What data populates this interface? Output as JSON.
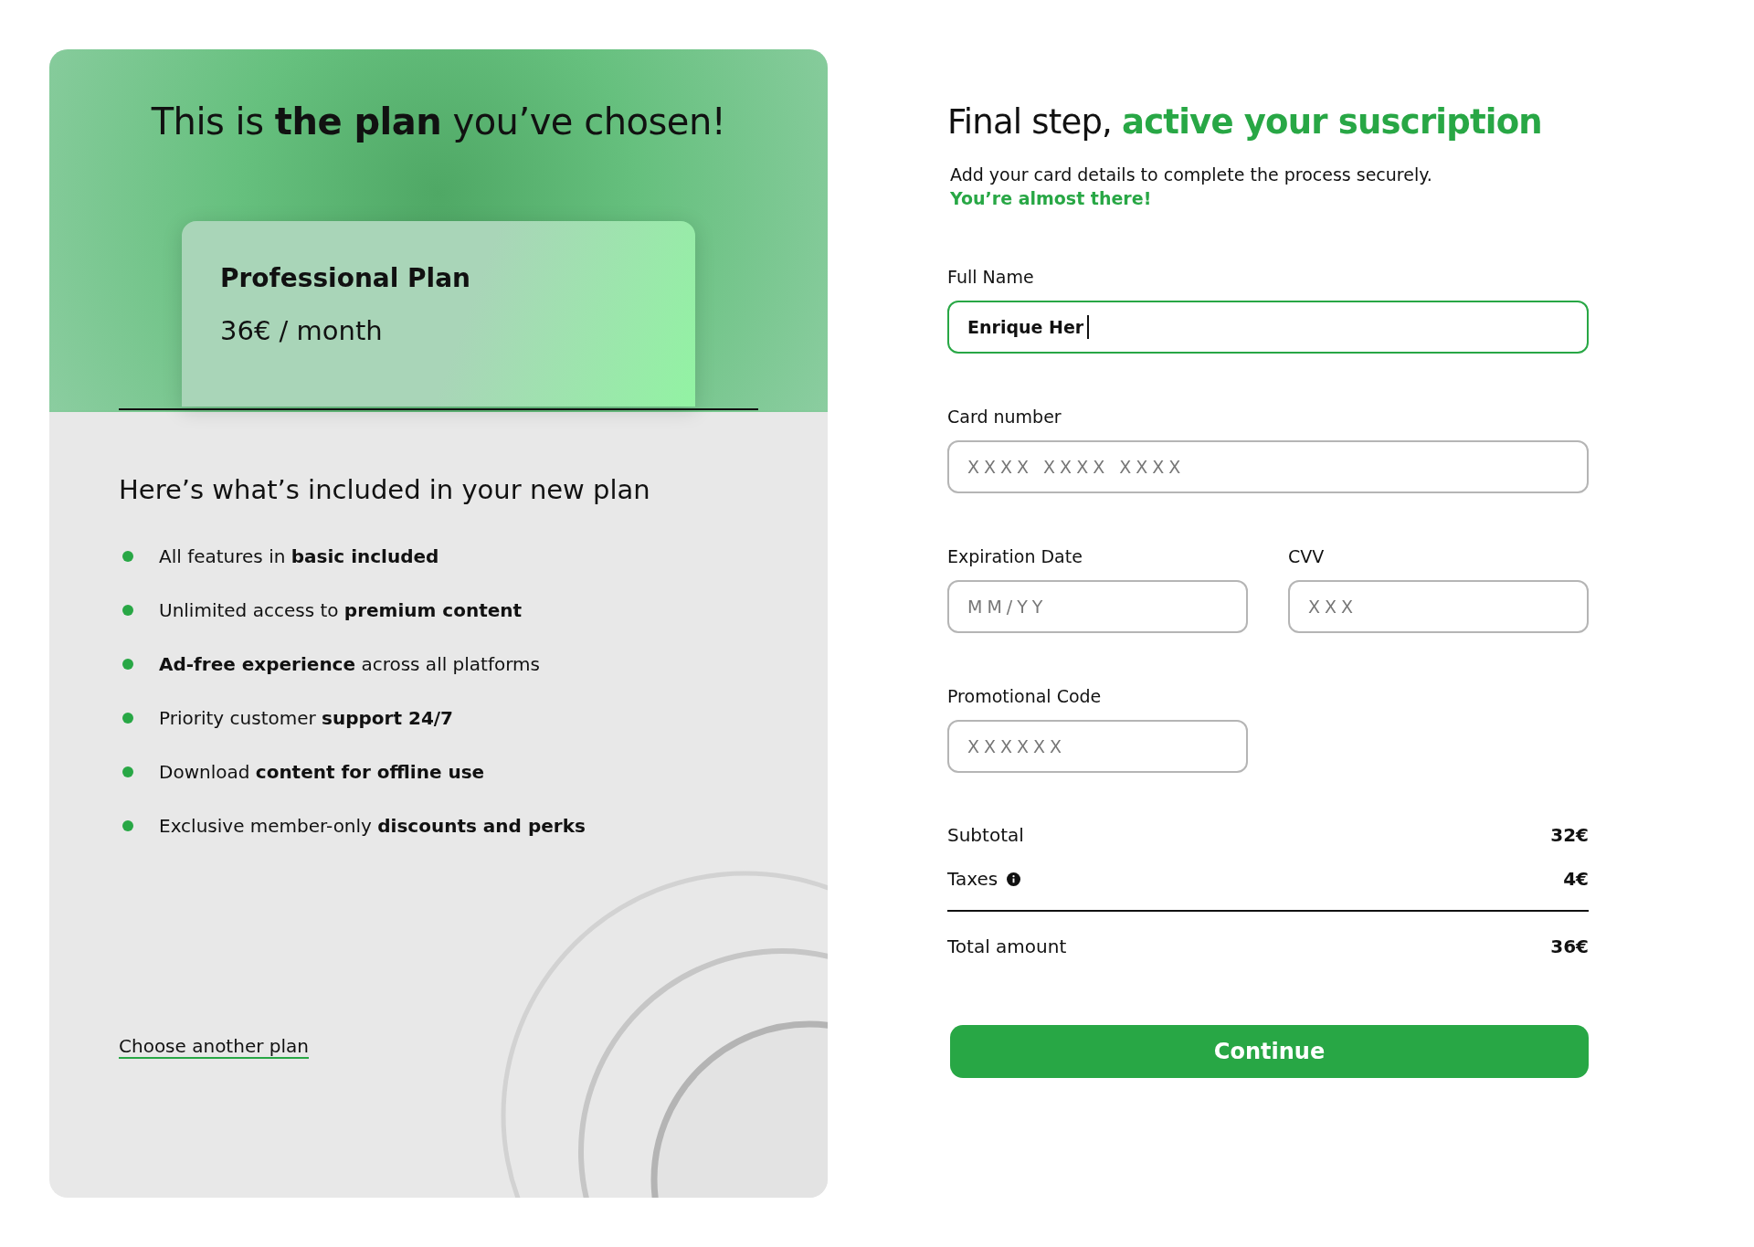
{
  "plan_panel": {
    "headline": "This is **the plan** you’ve chosen!",
    "plan": {
      "name": "Professional Plan",
      "price": "36€ / month"
    },
    "features_title": "Here’s what’s included in your new plan",
    "features": [
      {
        "text": "All features in **basic included**",
        "color": "#28a745"
      },
      {
        "text": "Unlimited access to **premium content**",
        "color": "#28a745"
      },
      {
        "text": "**Ad-free experience** across all platforms",
        "color": "#28a745"
      },
      {
        "text": "Priority customer **support 24/7**",
        "color": "#28a745"
      },
      {
        "text": "Download **content for offline use**",
        "color": "#28a745"
      },
      {
        "text": "Exclusive member-only **discounts and perks**",
        "color": "#28a745"
      }
    ],
    "link": "Choose another plan"
  },
  "checkout": {
    "title": "Final step, **active your suscription**",
    "subtitle": "Add your card details to complete the process securely.",
    "note": "You’re almost there!",
    "full_name": {
      "label": "Full Name",
      "value": "Enrique Her",
      "focused": true
    },
    "card_number": {
      "label": "Card number",
      "placeholder": "XXXX XXXX XXXX",
      "focused": false
    },
    "expiration": {
      "label": "Expiration Date",
      "placeholder": "MM/YY",
      "focused": false
    },
    "cvv": {
      "label": "CVV",
      "placeholder": "XXX",
      "focused": false
    },
    "promo": {
      "label": "Promotional Code",
      "placeholder": "XXXXXX",
      "focused": false
    },
    "summary": [
      {
        "label": "Subtotal",
        "value": "32€",
        "info": false
      },
      {
        "label": "Taxes",
        "value": "4€",
        "info": true
      }
    ],
    "total": {
      "label": "Total amount",
      "value": "36€"
    },
    "button": "Continue"
  }
}
